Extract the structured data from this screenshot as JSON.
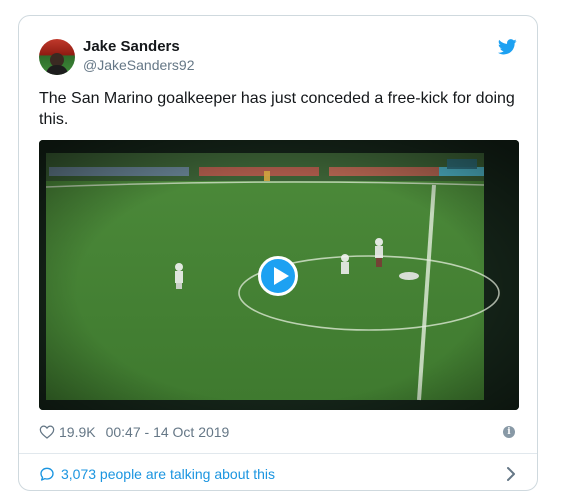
{
  "tweet": {
    "author_name": "Jake Sanders",
    "author_handle": "@JakeSanders92",
    "text": "The San Marino goalkeeper has just conceded a free-kick for doing this.",
    "likes": "19.9K",
    "timestamp": "00:47 - 14 Oct 2019",
    "conversation": "3,073 people are talking about this"
  },
  "icons": {
    "brand": "twitter-bird-icon",
    "play": "play-icon",
    "like": "heart-icon",
    "info": "info-icon",
    "conversation": "speech-bubble-icon",
    "expand": "chevron-right-icon"
  },
  "colors": {
    "brand_blue": "#1da1f2",
    "link_blue": "#1b95e0",
    "muted_text": "#657786",
    "primary_text": "#14171a",
    "border": "#cfd9de"
  }
}
